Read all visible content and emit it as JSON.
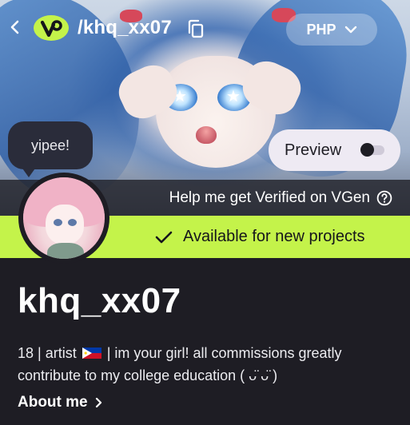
{
  "header": {
    "handle_path": "/khq_xx07",
    "currency": "PHP"
  },
  "banner": {
    "speech_bubble": "yipee!",
    "preview_label": "Preview",
    "preview_enabled": false,
    "verify_text": "Help me get Verified on VGen"
  },
  "status": {
    "available_text": "Available for new projects",
    "accent_color": "#c4f34a"
  },
  "profile": {
    "username": "khq_xx07",
    "bio_part1": "18 | artist",
    "bio_part2": "| im your girl! all commissions greatly contribute to my college education ( ᴗ̈ ᴗ̈ )",
    "about_label": "About me"
  },
  "icons": {
    "back": "chevron-left-icon",
    "logo": "vgen-logo-icon",
    "copy": "copy-icon",
    "dropdown": "chevron-down-icon",
    "help": "question-circle-icon",
    "check": "check-icon",
    "flag": "philippines-flag-icon",
    "about_arrow": "chevron-right-icon"
  }
}
